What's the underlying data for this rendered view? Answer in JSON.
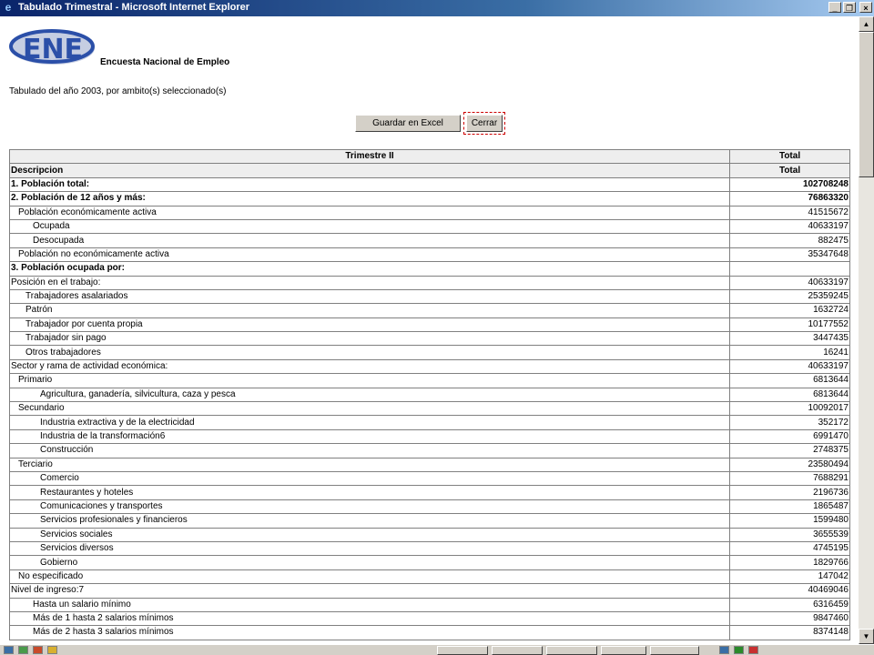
{
  "window": {
    "title": "Tabulado Trimestral - Microsoft Internet Explorer"
  },
  "header": {
    "logo_text": "ENE",
    "app_name": "Encuesta Nacional de Empleo",
    "subtitle": "Tabulado del año 2003, por ambito(s) seleccionado(s)"
  },
  "actions": {
    "excel_label": "Guardar en Excel",
    "close_label": "Cerrar"
  },
  "table": {
    "header_row1": {
      "label": "Trimestre II",
      "value": "Total"
    },
    "header_row2": {
      "label": "Descripcion",
      "value": "Total"
    },
    "rows": [
      {
        "label": "1. Población total:",
        "value": "102708248",
        "indent": 0,
        "bold": true
      },
      {
        "label": "2. Población de 12 años y más:",
        "value": "76863320",
        "indent": 0,
        "bold": true
      },
      {
        "label": "Población económicamente activa",
        "value": "41515672",
        "indent": 1,
        "bold": false
      },
      {
        "label": "Ocupada",
        "value": "40633197",
        "indent": 3,
        "bold": false
      },
      {
        "label": "Desocupada",
        "value": "882475",
        "indent": 3,
        "bold": false
      },
      {
        "label": "Población no económicamente activa",
        "value": "35347648",
        "indent": 1,
        "bold": false
      },
      {
        "label": "3. Población ocupada por:",
        "value": "",
        "indent": 0,
        "bold": true
      },
      {
        "label": "Posición en el trabajo:",
        "value": "40633197",
        "indent": 0,
        "bold": false
      },
      {
        "label": "Trabajadores asalariados",
        "value": "25359245",
        "indent": 2,
        "bold": false
      },
      {
        "label": "Patrón",
        "value": "1632724",
        "indent": 2,
        "bold": false
      },
      {
        "label": "Trabajador por cuenta propia",
        "value": "10177552",
        "indent": 2,
        "bold": false
      },
      {
        "label": "Trabajador sin pago",
        "value": "3447435",
        "indent": 2,
        "bold": false
      },
      {
        "label": "Otros trabajadores",
        "value": "16241",
        "indent": 2,
        "bold": false
      },
      {
        "label": "Sector y rama de actividad económica:",
        "value": "40633197",
        "indent": 0,
        "bold": false
      },
      {
        "label": "Primario",
        "value": "6813644",
        "indent": 1,
        "bold": false
      },
      {
        "label": "Agricultura, ganadería, silvicultura, caza y pesca",
        "value": "6813644",
        "indent": 4,
        "bold": false
      },
      {
        "label": "Secundario",
        "value": "10092017",
        "indent": 1,
        "bold": false
      },
      {
        "label": "Industria extractiva y de la electricidad",
        "value": "352172",
        "indent": 4,
        "bold": false
      },
      {
        "label": "Industria de la transformación6",
        "value": "6991470",
        "indent": 4,
        "bold": false
      },
      {
        "label": "Construcción",
        "value": "2748375",
        "indent": 4,
        "bold": false
      },
      {
        "label": "Terciario",
        "value": "23580494",
        "indent": 1,
        "bold": false
      },
      {
        "label": "Comercio",
        "value": "7688291",
        "indent": 4,
        "bold": false
      },
      {
        "label": "Restaurantes y hoteles",
        "value": "2196736",
        "indent": 4,
        "bold": false
      },
      {
        "label": "Comunicaciones y transportes",
        "value": "1865487",
        "indent": 4,
        "bold": false
      },
      {
        "label": "Servicios profesionales y financieros",
        "value": "1599480",
        "indent": 4,
        "bold": false
      },
      {
        "label": "Servicios sociales",
        "value": "3655539",
        "indent": 4,
        "bold": false
      },
      {
        "label": "Servicios diversos",
        "value": "4745195",
        "indent": 4,
        "bold": false
      },
      {
        "label": "Gobierno",
        "value": "1829766",
        "indent": 4,
        "bold": false
      },
      {
        "label": "No especificado",
        "value": "147042",
        "indent": 1,
        "bold": false
      },
      {
        "label": "Nivel de ingreso:7",
        "value": "40469046",
        "indent": 0,
        "bold": false
      },
      {
        "label": "Hasta un salario mínimo",
        "value": "6316459",
        "indent": 3,
        "bold": false
      },
      {
        "label": "Más de 1 hasta 2 salarios mínimos",
        "value": "9847460",
        "indent": 3,
        "bold": false
      },
      {
        "label": "Más de 2 hasta 3 salarios mínimos",
        "value": "8374148",
        "indent": 3,
        "bold": false
      }
    ]
  },
  "icons": {
    "title": "ie-icon",
    "minimize": "minimize-icon",
    "maximize": "restore-icon",
    "close": "close-icon",
    "scroll_up": "arrow-up-icon",
    "scroll_down": "arrow-down-icon"
  },
  "colors": {
    "titlebar": "#0a246a",
    "chrome": "#d4d0c8",
    "logo_blue": "#2b4fa8",
    "header_row": "#eeeeee"
  }
}
